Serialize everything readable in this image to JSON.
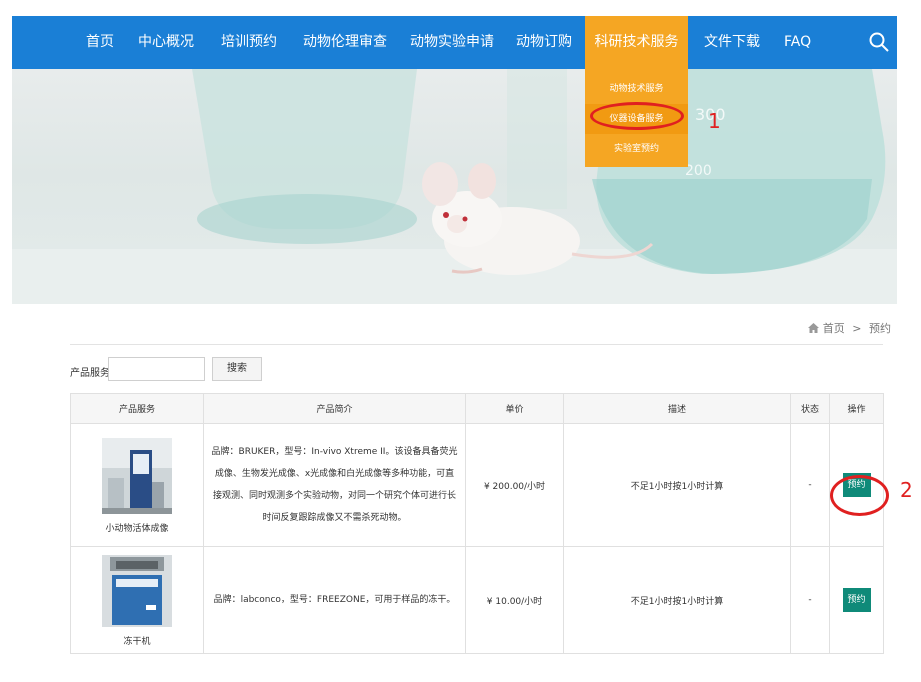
{
  "nav": {
    "items": [
      {
        "label": "首页"
      },
      {
        "label": "中心概况"
      },
      {
        "label": "培训预约"
      },
      {
        "label": "动物伦理审查"
      },
      {
        "label": "动物实验申请"
      },
      {
        "label": "动物订购"
      },
      {
        "label": "科研技术服务",
        "active": true
      },
      {
        "label": "文件下载"
      },
      {
        "label": "FAQ"
      }
    ],
    "search_icon": "search-icon",
    "dropdown": [
      "动物技术服务",
      "仪器设备服务",
      "实验室预约"
    ]
  },
  "annotations": {
    "first": "1",
    "second": "2",
    "color": "#e02020"
  },
  "banner": {
    "beaker_marks": [
      "300",
      "200"
    ]
  },
  "breadcrumb": {
    "home": "首页",
    "separator": ">",
    "current": "预约"
  },
  "search": {
    "label": "产品服务",
    "input_value": "",
    "button": "搜索"
  },
  "table": {
    "headers": [
      "产品服务",
      "产品简介",
      "单价",
      "描述",
      "状态",
      "操作"
    ],
    "rows": [
      {
        "name": "小动物活体成像",
        "intro": "品牌：BRUKER，型号：In-vivo Xtreme II。该设备具备荧光成像、生物发光成像、x光成像和白光成像等多种功能，可直接观测、同时观测多个实验动物，对同一个研究个体可进行长时间反复跟踪成像又不需杀死动物。",
        "price": "¥ 200.00/小时",
        "desc": "不足1小时按1小时计算",
        "status": "-",
        "action": "预约"
      },
      {
        "name": "冻干机",
        "intro": "品牌：labconco，型号：FREEZONE，可用于样品的冻干。",
        "price": "¥ 10.00/小时",
        "desc": "不足1小时按1小时计算",
        "status": "-",
        "action": "预约"
      }
    ]
  },
  "colors": {
    "nav_bg": "#1a7fd6",
    "active_bg": "#f5a623",
    "button_bg": "#0f8a79"
  }
}
